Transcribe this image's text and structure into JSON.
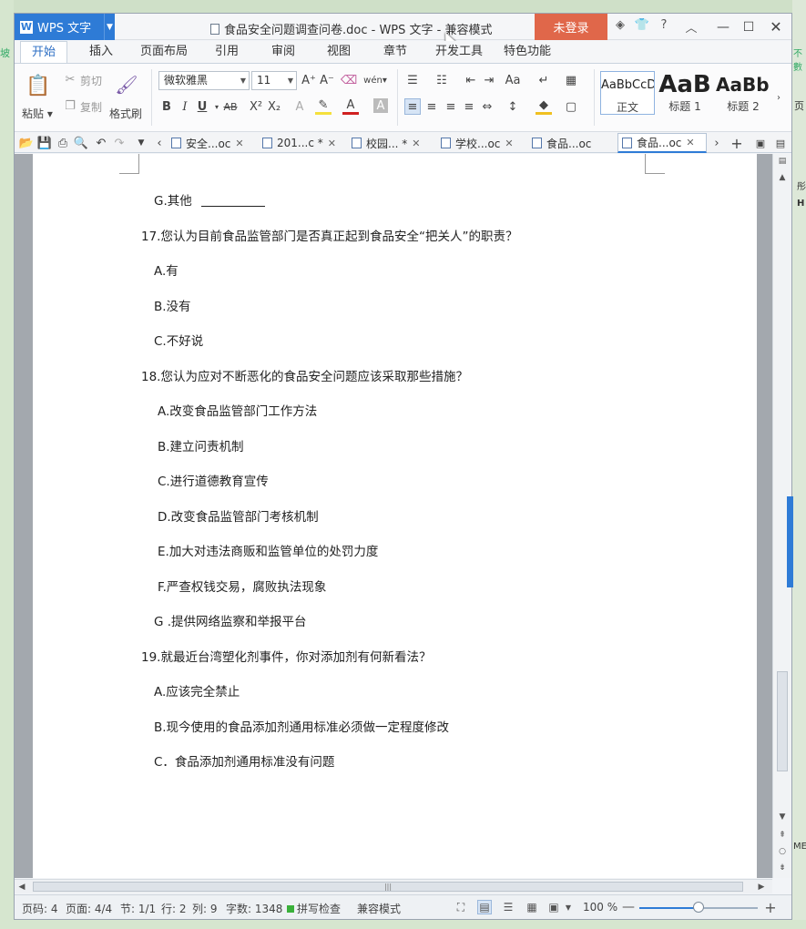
{
  "background": {
    "left_fragment": "坡",
    "right_fragments": [
      "不數",
      "页",
      "彤",
      "H",
      "ME"
    ]
  },
  "titlebar": {
    "app_name": "WPS 文字",
    "window_title": "食品安全问题调查问卷.doc - WPS 文字 - 兼容模式",
    "login_label": "未登录",
    "help_label": "?"
  },
  "ribbon_tabs": [
    "开始",
    "插入",
    "页面布局",
    "引用",
    "审阅",
    "视图",
    "章节",
    "开发工具",
    "特色功能"
  ],
  "ribbon": {
    "paste": "粘贴",
    "cut": "剪切",
    "copy": "复制",
    "format_painter": "格式刷",
    "font_name": "微软雅黑",
    "font_size": "11",
    "bold": "B",
    "italic": "I",
    "underline": "U",
    "strike": "AB",
    "styles": [
      {
        "sample": "AaBbCcD",
        "name": "正文"
      },
      {
        "sample": "AaB",
        "name": "标题 1"
      },
      {
        "sample": "AaBb(",
        "name": "标题 2"
      }
    ]
  },
  "doc_tabs": [
    {
      "label": "安全...oc",
      "modified": false
    },
    {
      "label": "201...c *",
      "modified": true
    },
    {
      "label": "校园... *",
      "modified": true
    },
    {
      "label": "学校...oc",
      "modified": false
    },
    {
      "label": "食品...oc",
      "modified": false
    },
    {
      "label": "食品...oc",
      "modified": false,
      "active": true
    }
  ],
  "document": {
    "lines": [
      {
        "text": "G.其他",
        "blank": true
      },
      {
        "text": "17.您认为目前食品监管部门是否真正起到食品安全“把关人”的职责？"
      },
      {
        "text": "A.有"
      },
      {
        "text": "B.没有"
      },
      {
        "text": "C.不好说"
      },
      {
        "text": "18.您认为应对不断恶化的食品安全问题应该采取那些措施？"
      },
      {
        "text": "A.改变食品监管部门工作方法"
      },
      {
        "text": "B.建立问责机制"
      },
      {
        "text": "C.进行道德教育宣传"
      },
      {
        "text": "D.改变食品监管部门考核机制"
      },
      {
        "text": "E.加大对违法商贩和监管单位的处罚力度"
      },
      {
        "text": "F.严查权钱交易，腐败执法现象"
      },
      {
        "text": "G .提供网络监察和举报平台"
      },
      {
        "text": "19.就最近台湾塑化剂事件，你对添加剂有何新看法？"
      },
      {
        "text": "A.应该完全禁止"
      },
      {
        "text": "B.现今使用的食品添加剂通用标准必须做一定程度修改"
      },
      {
        "text": "C．食品添加剂通用标准没有问题"
      }
    ]
  },
  "status": {
    "page_code": "页码: 4",
    "pages": "页面: 4/4",
    "section": "节: 1/1",
    "row": "行: 2",
    "col": "列: 9",
    "words": "字数: 1348",
    "spell": "拼写检查",
    "compat": "兼容模式",
    "zoom": "100 %",
    "zoom_fraction": 0.5
  }
}
